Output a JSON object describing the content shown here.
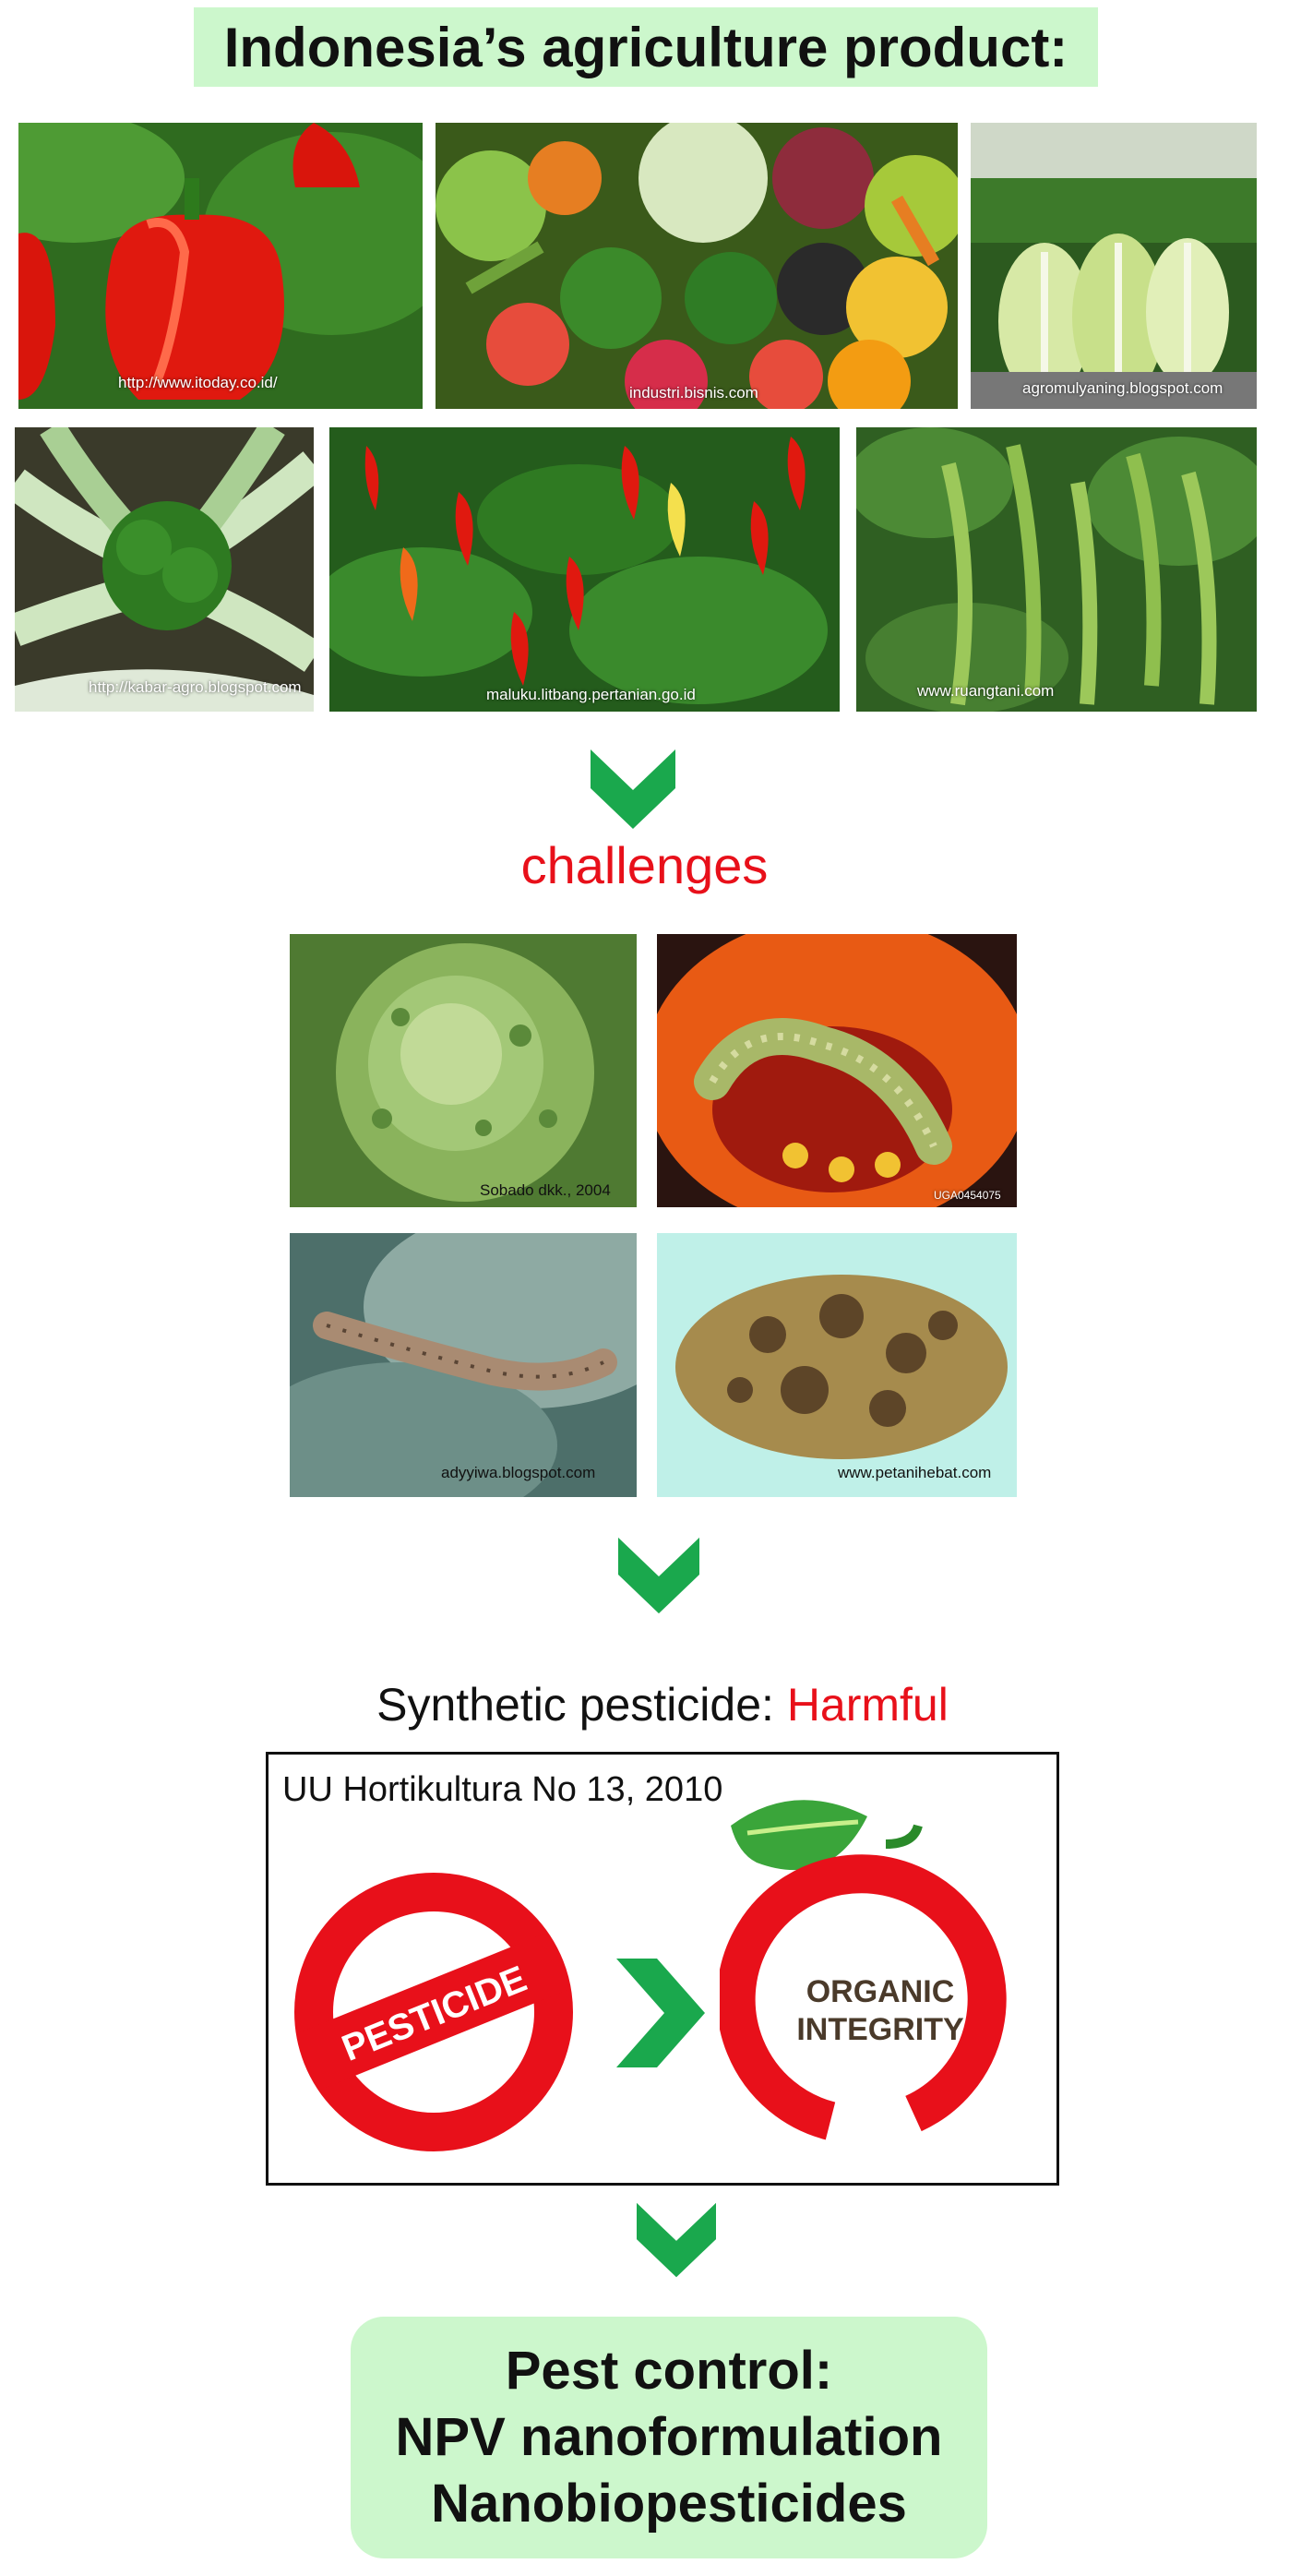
{
  "title": "Indonesia’s agriculture product:",
  "products": [
    {
      "name": "red bell pepper",
      "credit": "http://www.itoday.co.id/"
    },
    {
      "name": "mixed vegetables",
      "credit": "industri.bisnis.com"
    },
    {
      "name": "chinese cabbage",
      "credit": "agromulyaning.blogspot.com"
    },
    {
      "name": "broccoli plant",
      "credit": "http://kabar-agro.blogspot.com"
    },
    {
      "name": "chili peppers",
      "credit": "maluku.litbang.pertanian.go.id"
    },
    {
      "name": "green beans",
      "credit": "www.ruangtani.com"
    }
  ],
  "challenges_label": "challenges",
  "challenges": [
    {
      "name": "damaged cabbage",
      "credit": "Sobado dkk., 2004"
    },
    {
      "name": "worm in tomato",
      "credit": "UGA0454075"
    },
    {
      "name": "caterpillar on leaf",
      "credit": "adyyiwa.blogspot.com"
    },
    {
      "name": "scabbed potato",
      "credit": "www.petanihebat.com"
    }
  ],
  "synthetic": {
    "prefix": "Synthetic pesticide: ",
    "emphasis": "Harmful"
  },
  "law": "UU Hortikultura No 13, 2010",
  "pesticide_label": "PESTICIDE",
  "organic_line1": "ORGANIC",
  "organic_line2": "INTEGRITY",
  "pest_control": {
    "line1": "Pest control:",
    "line2": "NPV nanoformulation",
    "line3": "Nanobiopesticides"
  },
  "colors": {
    "accent_green": "#1aa84d",
    "alert_red": "#e8101a",
    "box_green": "#ccf7cc"
  }
}
